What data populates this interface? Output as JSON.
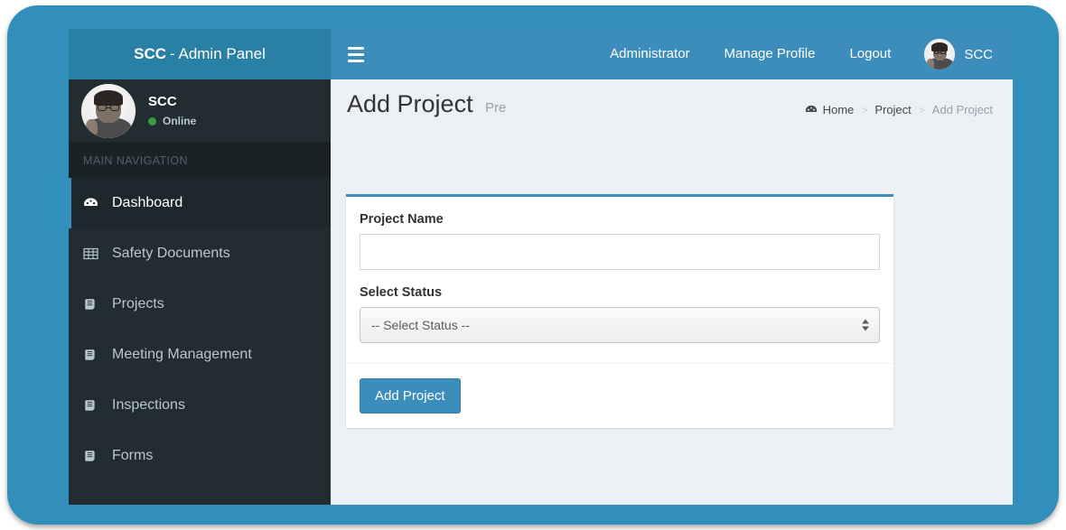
{
  "theme": {
    "frame_color": "#328fbb",
    "navbar_color": "#3c8dbc",
    "logo_bar_color": "#2a7fa5",
    "sidebar_color": "#222d32",
    "sidebar_active_color": "#1e282c",
    "content_bg_color": "#ecf0f5",
    "accent_color": "#3c8dbc",
    "online_color": "#3c9a41"
  },
  "logo": {
    "strong": "SCC",
    "rest": "- Admin Panel"
  },
  "navbar": {
    "menu_toggle_icon": "hamburger-icon",
    "links": [
      {
        "label": "Administrator",
        "name": "nav-link-administrator"
      },
      {
        "label": "Manage Profile",
        "name": "nav-link-manage-profile"
      },
      {
        "label": "Logout",
        "name": "nav-link-logout"
      }
    ],
    "user": {
      "name": "SCC",
      "avatar_icon": "user-avatar-photo"
    }
  },
  "sidebar": {
    "user": {
      "name": "SCC",
      "status": "Online",
      "avatar_icon": "user-avatar-photo"
    },
    "nav_header": "MAIN NAVIGATION",
    "items": [
      {
        "label": "Dashboard",
        "icon": "dashboard-gauge-icon",
        "active": true
      },
      {
        "label": "Safety Documents",
        "icon": "table-grid-icon",
        "active": false
      },
      {
        "label": "Projects",
        "icon": "book-icon",
        "active": false
      },
      {
        "label": "Meeting Management",
        "icon": "book-icon",
        "active": false
      },
      {
        "label": "Inspections",
        "icon": "book-icon",
        "active": false
      },
      {
        "label": "Forms",
        "icon": "book-icon",
        "active": false
      }
    ]
  },
  "content": {
    "title": "Add Project",
    "subtitle": "Pre",
    "breadcrumb": {
      "icon": "dashboard-gauge-icon",
      "items": [
        {
          "label": "Home",
          "current": false
        },
        {
          "label": "Project",
          "current": false
        },
        {
          "label": "Add Project",
          "current": true
        }
      ],
      "separator": ">"
    },
    "form": {
      "fields": [
        {
          "type": "text",
          "label": "Project Name",
          "value": "",
          "placeholder": ""
        },
        {
          "type": "select",
          "label": "Select Status",
          "selected": "-- Select Status --",
          "options": [
            "-- Select Status --"
          ]
        }
      ],
      "submit_label": "Add Project"
    }
  }
}
